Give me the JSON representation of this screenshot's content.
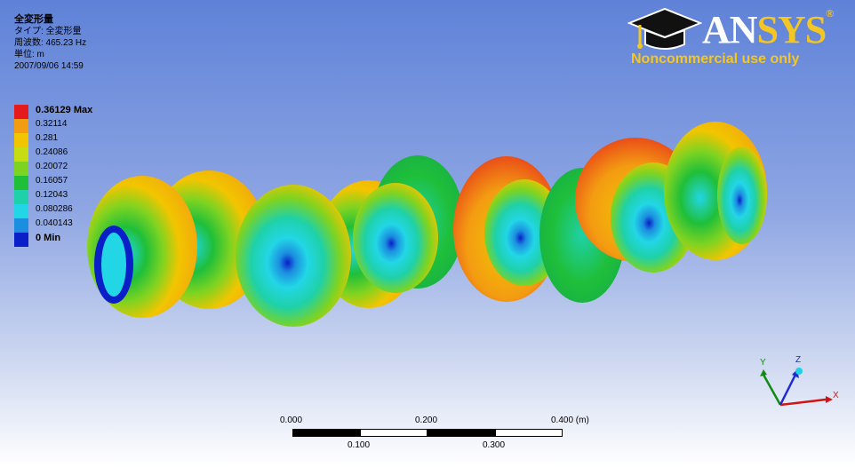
{
  "result": {
    "title": "全変形量",
    "type_line": "タイプ: 全変形量",
    "frequency_line": "周波数: 465.23 Hz",
    "unit_line": "単位: m",
    "timestamp": "2007/09/06 14:59"
  },
  "legend": {
    "items": [
      {
        "label": "0.36129 Max",
        "color": "#e41a1c",
        "bold": true
      },
      {
        "label": "0.32114",
        "color": "#f39c12",
        "bold": false
      },
      {
        "label": "0.281",
        "color": "#f2c500",
        "bold": false
      },
      {
        "label": "0.24086",
        "color": "#c8dc14",
        "bold": false
      },
      {
        "label": "0.20072",
        "color": "#7ed321",
        "bold": false
      },
      {
        "label": "0.16057",
        "color": "#1fbf3a",
        "bold": false
      },
      {
        "label": "0.12043",
        "color": "#1fd1a8",
        "bold": false
      },
      {
        "label": "0.080286",
        "color": "#22d6e6",
        "bold": false
      },
      {
        "label": "0.040143",
        "color": "#1c8ee0",
        "bold": false
      },
      {
        "label": "0 Min",
        "color": "#0a1fc8",
        "bold": true
      }
    ]
  },
  "logo": {
    "brand_an": "AN",
    "brand_sys": "SYS",
    "registered": "®",
    "tagline": "Noncommercial use only"
  },
  "triad": {
    "x": "X",
    "y": "Y",
    "z": "Z"
  },
  "scale_bar": {
    "top_labels": [
      "0.000",
      "0.200",
      "0.400 (m)"
    ],
    "bottom_labels": [
      "0.100",
      "0.300"
    ]
  }
}
